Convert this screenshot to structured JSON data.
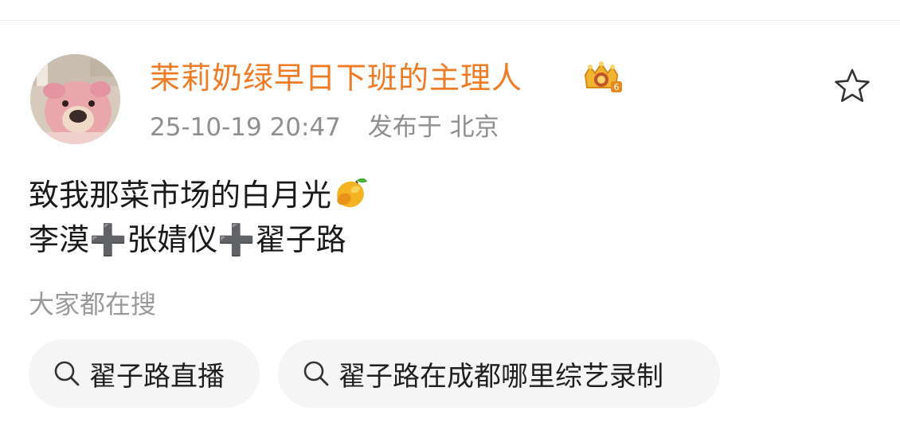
{
  "post": {
    "author": {
      "name": "茉莉奶绿早日下班的主理人",
      "badge_icon": "crown-vip-badge-icon",
      "avatar_icon": "pig-dog-avatar-image"
    },
    "meta": {
      "timestamp": "25-10-19 20:47",
      "location": "发布于 北京"
    },
    "actions": {
      "favorite_icon": "star-outline-icon"
    },
    "content": {
      "line1": "致我那菜市场的白月光",
      "line1_emoji": "mango-icon",
      "line2": "李漠➕张婧仪➕翟子路"
    }
  },
  "related_search": {
    "heading": "大家都在搜",
    "icon": "search-icon",
    "chips": [
      {
        "label": "翟子路直播"
      },
      {
        "label": "翟子路在成都哪里综艺录制"
      }
    ]
  },
  "colors": {
    "username": "#f07b25",
    "meta_text": "#8f8f8f",
    "chip_bg": "#f5f5f5"
  }
}
